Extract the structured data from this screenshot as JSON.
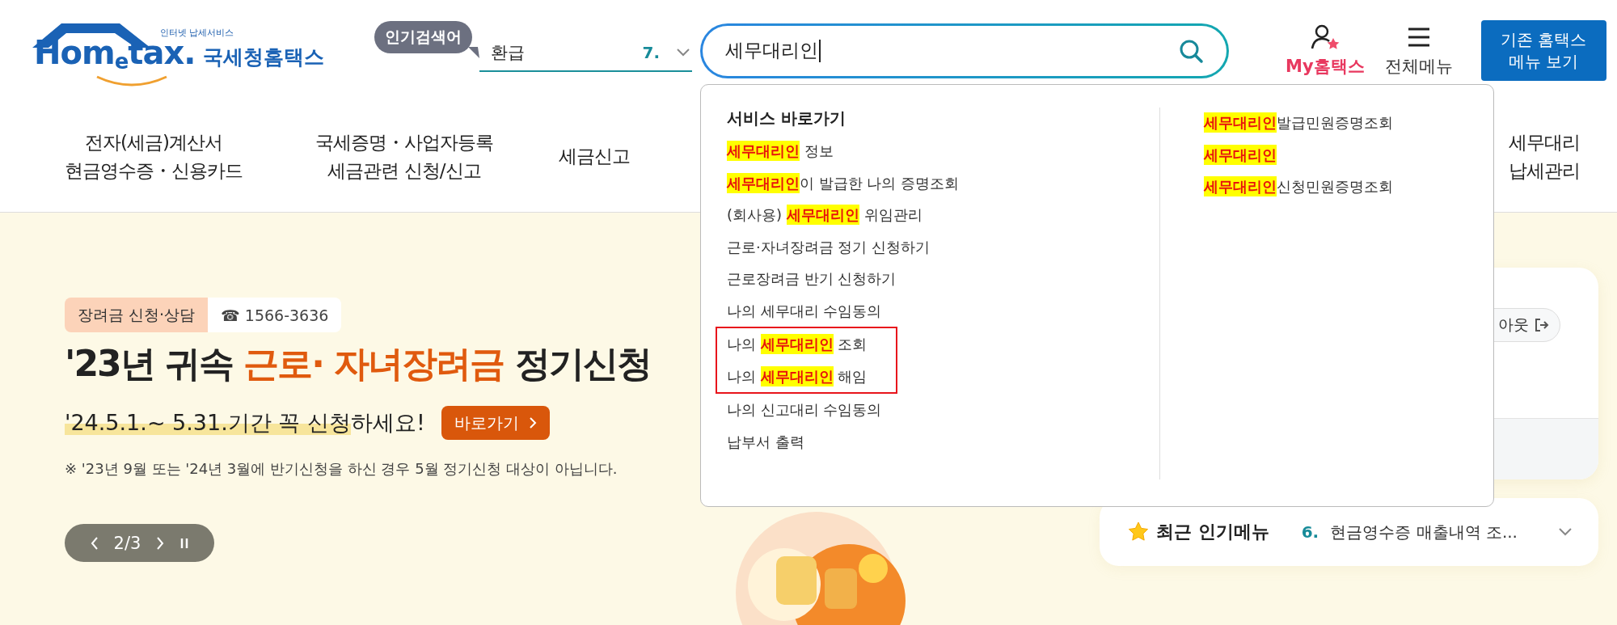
{
  "logo": {
    "tagline": "인터넷 납세서비스",
    "wordmark": "Hom$_{e}$tax.",
    "name": "국세청홈택스"
  },
  "popular_search": {
    "badge": "인기검색어",
    "term": "환급",
    "rank": "7."
  },
  "search": {
    "value": "세무대리인"
  },
  "header_links": [
    {
      "label": "My홈택스",
      "kind": "my"
    },
    {
      "label": "전체메뉴",
      "kind": "menu"
    }
  ],
  "legacy_button": {
    "lines": [
      "기존 홈택스",
      "메뉴 보기"
    ]
  },
  "nav": [
    {
      "lines": [
        "전자(세금)계산서",
        "현금영수증・신용카드"
      ]
    },
    {
      "lines": [
        "국세증명・사업자등록",
        "세금관련 신청/신고"
      ]
    },
    {
      "lines": [
        "세금신고"
      ]
    },
    {
      "lines": [
        "세무대리",
        "납세관리"
      ]
    }
  ],
  "dropdown": {
    "heading": "서비스 바로가기",
    "left_items": [
      {
        "text": "**세무대리인** 정보",
        "marked": false
      },
      {
        "text": "**세무대리인**이 발급한 나의 증명조회",
        "marked": false
      },
      {
        "text": "(회사용) **세무대리인** 위임관리",
        "marked": false
      },
      {
        "text": "근로·자녀장려금 정기 신청하기",
        "marked": false
      },
      {
        "text": "근로장려금 반기 신청하기",
        "marked": false
      },
      {
        "text": "나의 세무대리 수임동의",
        "marked": false
      },
      {
        "text": "나의 **세무대리인** 조회",
        "marked": true
      },
      {
        "text": "나의 **세무대리인** 해임",
        "marked": true
      },
      {
        "text": "나의 신고대리 수임동의",
        "marked": false
      },
      {
        "text": "납부서 출력",
        "marked": false
      }
    ],
    "right_items": [
      {
        "text": "**세무대리인**발급민원증명조회"
      },
      {
        "text": "**세무대리인**"
      },
      {
        "text": "**세무대리인**신청민원증명조회"
      }
    ]
  },
  "banner": {
    "tag": "장려금 신청·상담",
    "phone": "☎ 1566-3636",
    "title": [
      {
        "text": "'23년 귀속 ",
        "accent": false
      },
      {
        "text": "근로· 자녀장려금",
        "accent": true
      },
      {
        "text": " 정기신청",
        "accent": false
      }
    ],
    "subtitle": [
      {
        "text": "'24.5.1.~ 5.31.기간 꼭 신청",
        "highlight": true
      },
      {
        "text": "하세요!",
        "highlight": false
      }
    ],
    "button": "바로가기",
    "note": "※ '23년 9월 또는 '24년 3월에 반기신청을 하신 경우 5월 정기신청 대상이 아닙니다.",
    "pager": "2/3"
  },
  "login_card": {
    "logout": "아웃"
  },
  "popular_menu": {
    "title": "최근 인기메뉴",
    "rank": "6.",
    "item": "현금영수증 매출내역 조..."
  }
}
